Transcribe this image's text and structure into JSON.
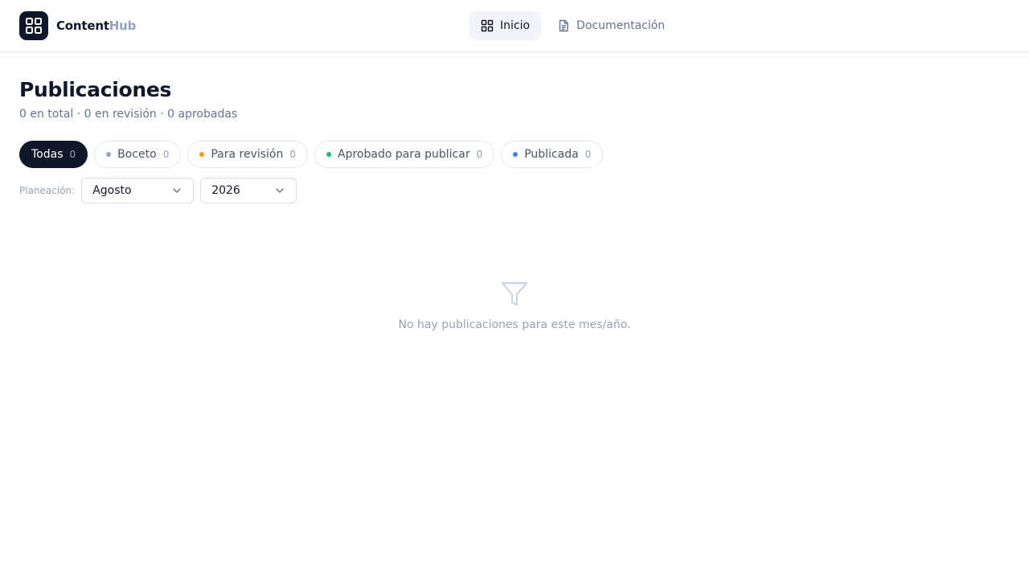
{
  "brand": {
    "name_a": "Content",
    "name_b": "Hub",
    "logo_icon": "grid-icon"
  },
  "nav": [
    {
      "label": "Inicio",
      "icon": "grid-icon",
      "active": true
    },
    {
      "label": "Documentación",
      "icon": "document-icon",
      "active": false
    }
  ],
  "page": {
    "title": "Publicaciones",
    "subtitle": "0 en total · 0 en revisión · 0 aprobadas"
  },
  "filters": [
    {
      "label": "Todas",
      "count": "0",
      "dot_color": null,
      "active": true
    },
    {
      "label": "Boceto",
      "count": "0",
      "dot_color": "#94a3b8",
      "active": false
    },
    {
      "label": "Para revisión",
      "count": "0",
      "dot_color": "#f59e0b",
      "active": false
    },
    {
      "label": "Aprobado para publicar",
      "count": "0",
      "dot_color": "#10b981",
      "active": false
    },
    {
      "label": "Publicada",
      "count": "0",
      "dot_color": "#3b82f6",
      "active": false
    }
  ],
  "planning": {
    "label": "Planeación:",
    "month": "Agosto",
    "year": "2026"
  },
  "empty_state": {
    "icon": "filter-icon",
    "message": "No hay publicaciones para este mes/año."
  },
  "colors": {
    "primary": "#0f172a",
    "muted": "#94a3b8",
    "border": "#e2e8f0"
  }
}
